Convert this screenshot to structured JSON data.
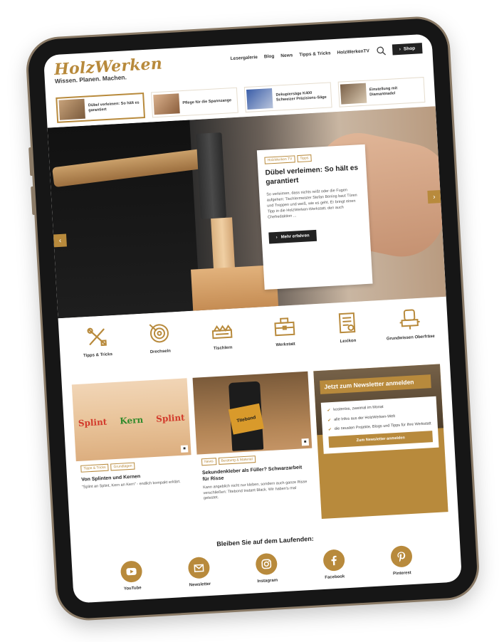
{
  "site": {
    "logo": "HolzWerken",
    "tagline": "Wissen. Planen. Machen."
  },
  "nav": {
    "items": [
      "Lesergalerie",
      "Blog",
      "News",
      "Tipps & Tricks",
      "HolzWerkenTV"
    ],
    "shop_label": "Shop"
  },
  "strip": [
    {
      "label": "Dübel verleimen: So hält es garantiert",
      "active": true
    },
    {
      "label": "Pflege für die Spannzange",
      "active": false
    },
    {
      "label": "Dekupiersäge K400 Schweizer Präzisions-Säge",
      "active": false
    },
    {
      "label": "Einstellung mit Diamantnadel",
      "active": false
    }
  ],
  "hero": {
    "tags": [
      "HolzWerken TV",
      "Tipps"
    ],
    "title": "Dübel verleimen: So hält es garantiert",
    "text": "So verleimen, dass nichts reißt oder die Fugen aufgehen: Tischlermeister Stefan Böning baut Türen und Treppen und weiß, wie es geht. Er bringt einen Tipp in die HolzWerken-Werkstatt, den auch Chefredaktion ...",
    "button": "Mehr erfahren"
  },
  "categories": [
    {
      "label": "Tipps & Tricks",
      "icon": "tools-icon"
    },
    {
      "label": "Drechseln",
      "icon": "lathe-icon"
    },
    {
      "label": "Tischlern",
      "icon": "saw-icon"
    },
    {
      "label": "Werkstatt",
      "icon": "toolbox-icon"
    },
    {
      "label": "Lexikon",
      "icon": "book-icon"
    },
    {
      "label": "Grundwissen Oberfräse",
      "icon": "router-icon"
    }
  ],
  "cards": [
    {
      "img_words": [
        "Splint",
        "Kern",
        "Splint"
      ],
      "tags": [
        "Tipps & Tricks",
        "Grundlagen"
      ],
      "title": "Von Splinten und Kernen",
      "text": "\"Splint an Splint, Kern an Kern\" - endlich kompakt erklärt."
    },
    {
      "img_label": "Titebond",
      "tags": [
        "News",
        "Beratung & Material"
      ],
      "title": "Sekundenkleber als Füller? Schwarzarbeit für Risse",
      "text": "Kann angeblich nicht nur kleben, sondern auch ganze Risse verschließen: Titebond Instant Black. Wir haben's mal getestet."
    }
  ],
  "newsletter": {
    "heading": "Jetzt zum Newsletter anmelden",
    "items": [
      "kostenlos, zweimal im Monat",
      "alle Infos aus der HolzWerken-Welt",
      "die neusten Projekte, Blogs und Tipps für Ihre Werkstatt"
    ],
    "button": "Zum Newsletter anmelden"
  },
  "follow": {
    "title": "Bleiben Sie auf dem Laufenden:",
    "socials": [
      {
        "label": "YouTube",
        "icon": "youtube-icon"
      },
      {
        "label": "Newsletter",
        "icon": "newsletter-icon"
      },
      {
        "label": "Instagram",
        "icon": "instagram-icon"
      },
      {
        "label": "Facebook",
        "icon": "facebook-icon"
      },
      {
        "label": "Pinterest",
        "icon": "pinterest-icon"
      }
    ]
  },
  "colors": {
    "brand": "#b88a3c",
    "dark": "#222222",
    "device": "#161616"
  }
}
